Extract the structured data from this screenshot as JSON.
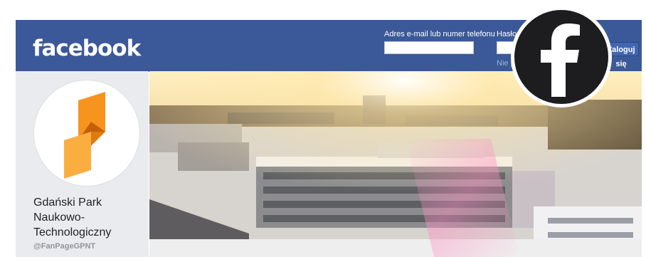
{
  "header": {
    "logo": "facebook",
    "email_label": "Adres e-mail lub numer telefonu",
    "password_label": "Hasło",
    "forgot_link": "Nie pamiętasz konta?",
    "login_button": "Zaloguj się"
  },
  "page": {
    "name_line1": "Gdański Park",
    "name_line2": "Naukowo-",
    "name_line3": "Technologiczny",
    "handle": "@FanPageGPNT"
  },
  "icons": {
    "profile": "gpnt-logo-icon",
    "badge": "facebook-f-icon"
  },
  "colors": {
    "header_bg": "#3b5998",
    "logo_orange": "#f7941d",
    "badge_bg": "#1d1d1f"
  }
}
